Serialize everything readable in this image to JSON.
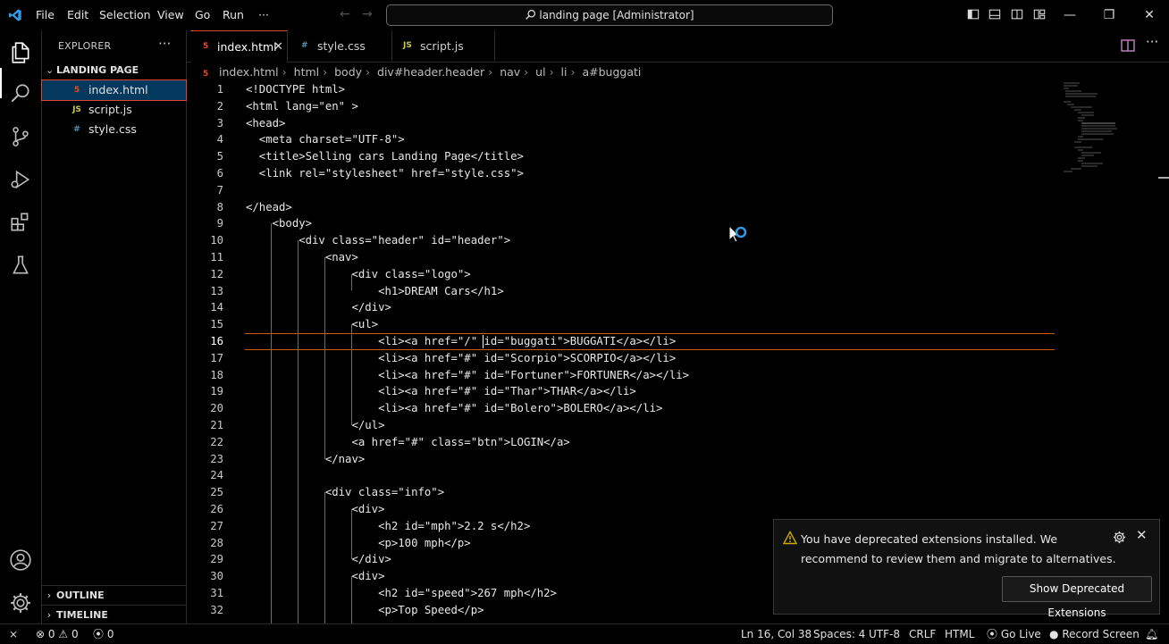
{
  "menu": [
    "File",
    "Edit",
    "Selection",
    "View",
    "Go",
    "Run",
    "···"
  ],
  "command_center": "landing page [Administrator]",
  "explorer": {
    "title": "EXPLORER",
    "more": "···",
    "folder": "LANDING PAGE",
    "files": [
      {
        "icon": "5",
        "name": "index.html",
        "color": "#e44d26"
      },
      {
        "icon": "JS",
        "name": "script.js",
        "color": "#cbcb41"
      },
      {
        "icon": "#",
        "name": "style.css",
        "color": "#519aba"
      }
    ],
    "outline": "OUTLINE",
    "timeline": "TIMELINE"
  },
  "tabs": [
    {
      "icon": "5",
      "label": "index.html",
      "close": "✕",
      "color": "#e44d26"
    },
    {
      "icon": "#",
      "label": "style.css",
      "color": "#519aba"
    },
    {
      "icon": "JS",
      "label": "script.js",
      "color": "#cbcb41"
    }
  ],
  "breadcrumb": [
    "index.html",
    "html",
    "body",
    "div#header.header",
    "nav",
    "ul",
    "li",
    "a#buggati"
  ],
  "code_lines": [
    {
      "n": "1",
      "text": "<!DOCTYPE html>"
    },
    {
      "n": "2",
      "text": "<html lang=\"en\" >"
    },
    {
      "n": "3",
      "text": "<head>"
    },
    {
      "n": "4",
      "text": "  <meta charset=\"UTF-8\">"
    },
    {
      "n": "5",
      "text": "  <title>Selling cars Landing Page</title>"
    },
    {
      "n": "6",
      "text": "  <link rel=\"stylesheet\" href=\"style.css\">"
    },
    {
      "n": "7",
      "text": ""
    },
    {
      "n": "8",
      "text": "</head>"
    },
    {
      "n": "9",
      "text": "    <body>"
    },
    {
      "n": "10",
      "text": "        <div class=\"header\" id=\"header\">"
    },
    {
      "n": "11",
      "text": "            <nav>"
    },
    {
      "n": "12",
      "text": "                <div class=\"logo\">"
    },
    {
      "n": "13",
      "text": "                    <h1>DREAM Cars</h1>"
    },
    {
      "n": "14",
      "text": "                </div>"
    },
    {
      "n": "15",
      "text": "                <ul>"
    },
    {
      "n": "16",
      "text": "                    <li><a href=\"/\" id=\"buggati\">BUGGATI</a></li>"
    },
    {
      "n": "17",
      "text": "                    <li><a href=\"#\" id=\"Scorpio\">SCORPIO</a></li>"
    },
    {
      "n": "18",
      "text": "                    <li><a href=\"#\" id=\"Fortuner\">FORTUNER</a></li>"
    },
    {
      "n": "19",
      "text": "                    <li><a href=\"#\" id=\"Thar\">THAR</a></li>"
    },
    {
      "n": "20",
      "text": "                    <li><a href=\"#\" id=\"Bolero\">BOLERO</a></li>"
    },
    {
      "n": "21",
      "text": "                </ul>"
    },
    {
      "n": "22",
      "text": "                <a href=\"#\" class=\"btn\">LOGIN</a>"
    },
    {
      "n": "23",
      "text": "            </nav>"
    },
    {
      "n": "24",
      "text": ""
    },
    {
      "n": "25",
      "text": "            <div class=\"info\">"
    },
    {
      "n": "26",
      "text": "                <div>"
    },
    {
      "n": "27",
      "text": "                    <h2 id=\"mph\">2.2 s</h2>"
    },
    {
      "n": "28",
      "text": "                    <p>100 mph</p>"
    },
    {
      "n": "29",
      "text": "                </div>"
    },
    {
      "n": "30",
      "text": "                <div>"
    },
    {
      "n": "31",
      "text": "                    <h2 id=\"speed\">267 mph</h2>"
    },
    {
      "n": "32",
      "text": "                    <p>Top Speed</p>"
    }
  ],
  "notification": {
    "message": "You have deprecated extensions installed. We recommend to review them and migrate to alternatives.",
    "button": "Show Deprecated Extensions",
    "close": "✕"
  },
  "status": {
    "errors": "0",
    "warnings": "0",
    "ports": "0",
    "position": "Ln 16, Col 38",
    "spaces": "Spaces: 4",
    "encoding": "UTF-8",
    "eol": "CRLF",
    "language": "HTML",
    "golive": "Go Live",
    "record": "Record Screen"
  },
  "colors": {
    "accent": "#e04430",
    "html_icon": "#e44d26",
    "css_icon": "#519aba",
    "js_icon": "#cbcb41",
    "warning": "#cca700",
    "cursor_line": "#cc5a10"
  },
  "icons": [
    "vscode-logo-icon",
    "explorer-icon",
    "search-icon",
    "source-control-icon",
    "run-debug-icon",
    "extensions-icon",
    "testing-icon",
    "accounts-icon",
    "manage-gear-icon",
    "split-editor-icon",
    "warning-icon",
    "gear-icon",
    "close-icon",
    "remote-icon",
    "error-icon",
    "bell-icon"
  ]
}
